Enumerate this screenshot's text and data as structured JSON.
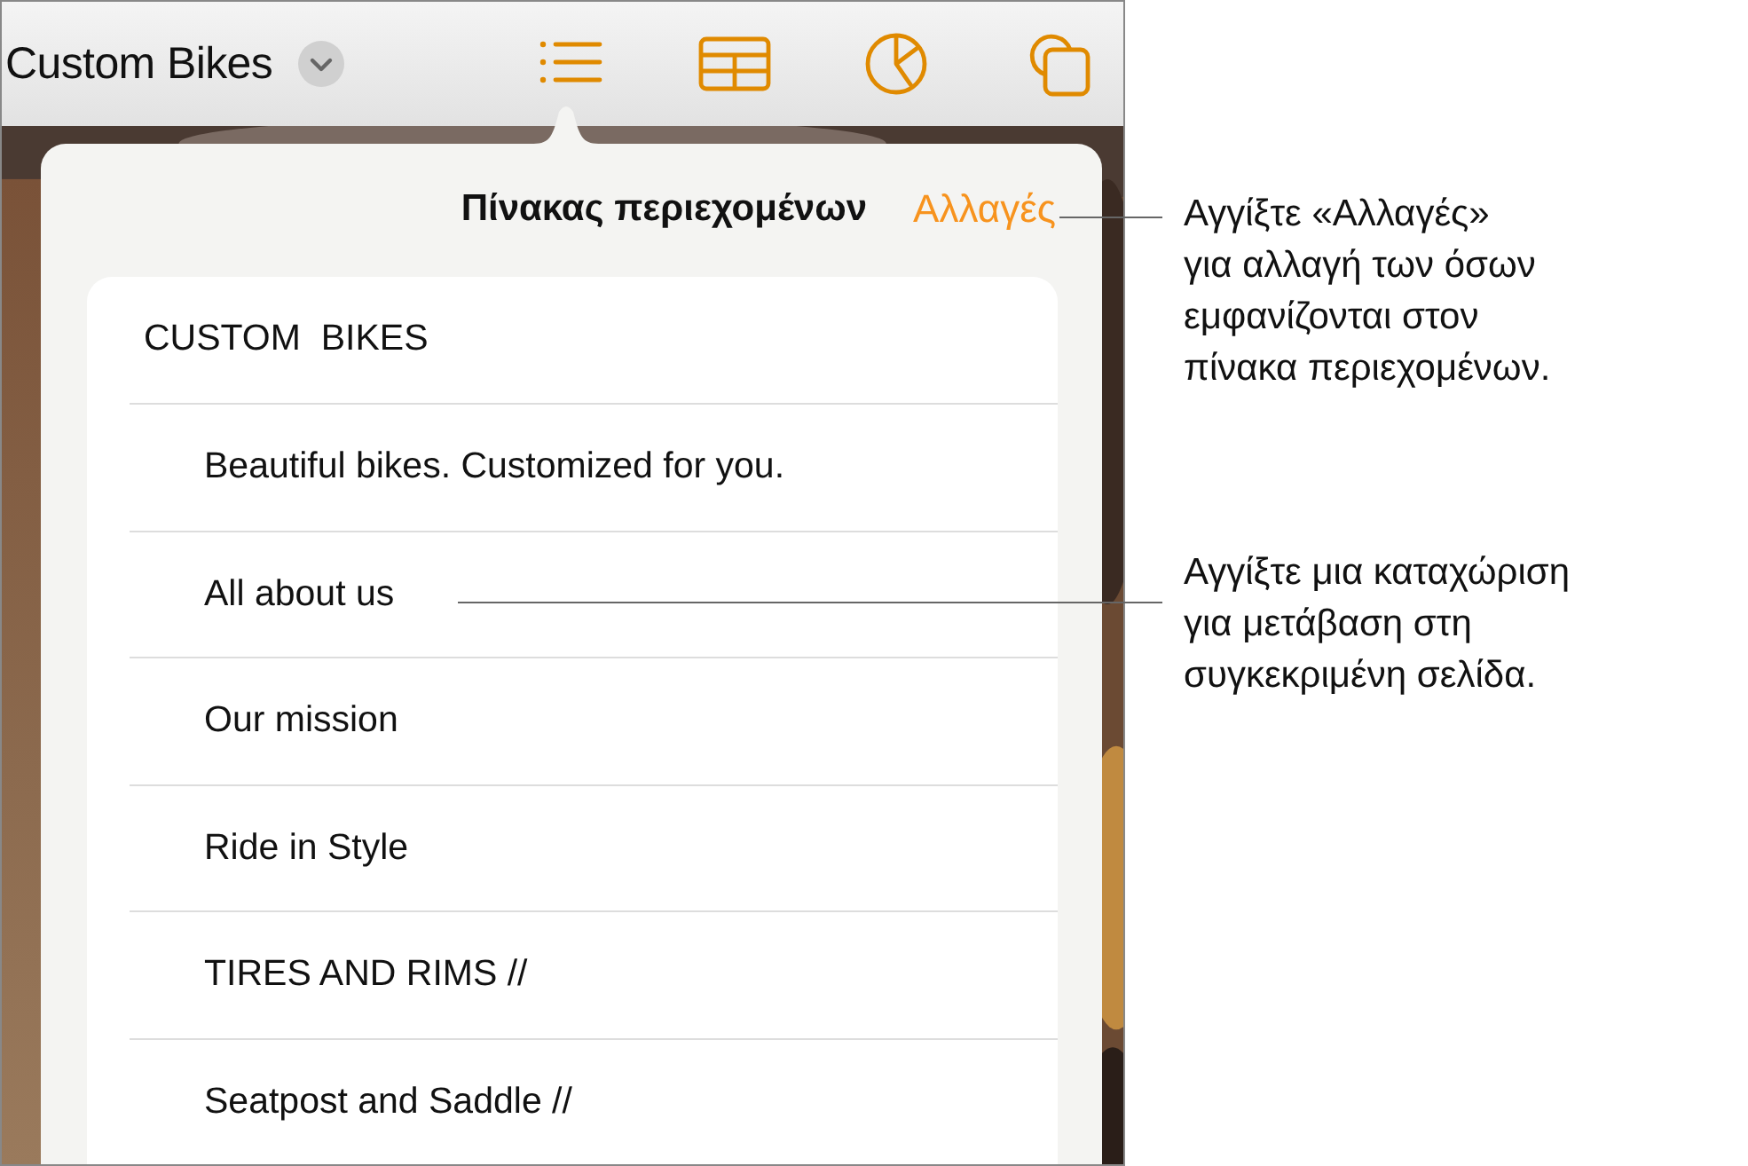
{
  "document": {
    "title": "Custom Bikes"
  },
  "toc": {
    "title": "Πίνακας περιεχομένων",
    "edit": "Αλλαγές",
    "items": [
      {
        "label": "CUSTOM  BIKES",
        "children": [
          {
            "label": "Beautiful bikes. Customized for you."
          },
          {
            "label": "All about us"
          },
          {
            "label": "Our mission"
          },
          {
            "label": "Ride in Style"
          },
          {
            "label": "TIRES AND RIMS //"
          },
          {
            "label": "Seatpost and Saddle //"
          }
        ]
      }
    ]
  },
  "callouts": [
    {
      "lines": [
        "Αγγίξτε «Αλλαγές»",
        "για αλλαγή των όσων",
        "εμφανίζονται στον",
        "πίνακα περιεχομένων."
      ]
    },
    {
      "lines": [
        "Αγγίξτε μια καταχώριση",
        "για μετάβαση στη",
        "συγκεκριμένη σελίδα."
      ]
    }
  ]
}
